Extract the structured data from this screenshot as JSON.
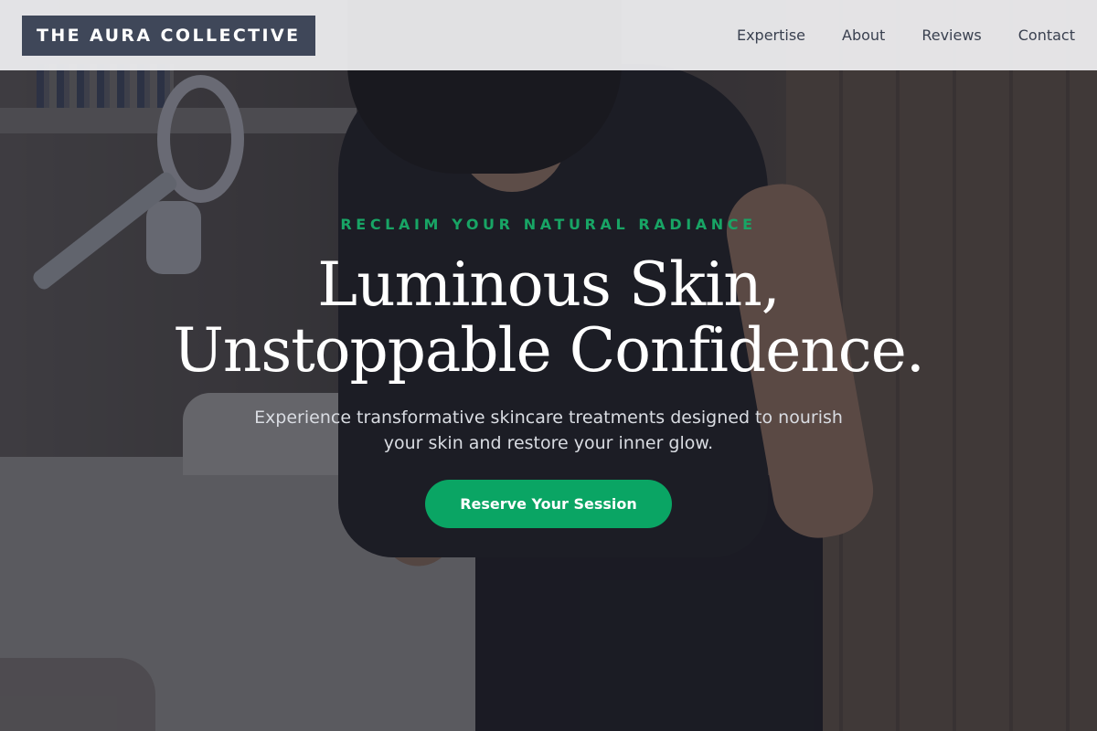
{
  "header": {
    "logo": "THE AURA COLLECTIVE",
    "nav": [
      {
        "label": "Expertise"
      },
      {
        "label": "About"
      },
      {
        "label": "Reviews"
      },
      {
        "label": "Contact"
      }
    ]
  },
  "hero": {
    "eyebrow": "RECLAIM YOUR NATURAL RADIANCE",
    "headline_line1": "Luminous Skin,",
    "headline_line2": "Unstoppable Confidence.",
    "subtext": "Experience transformative skincare treatments designed to nourish your skin and restore your inner glow.",
    "cta_label": "Reserve Your Session"
  },
  "colors": {
    "accent": "#0aa564",
    "logo_bg": "#3f4759",
    "header_bg": "#eeeef0"
  }
}
